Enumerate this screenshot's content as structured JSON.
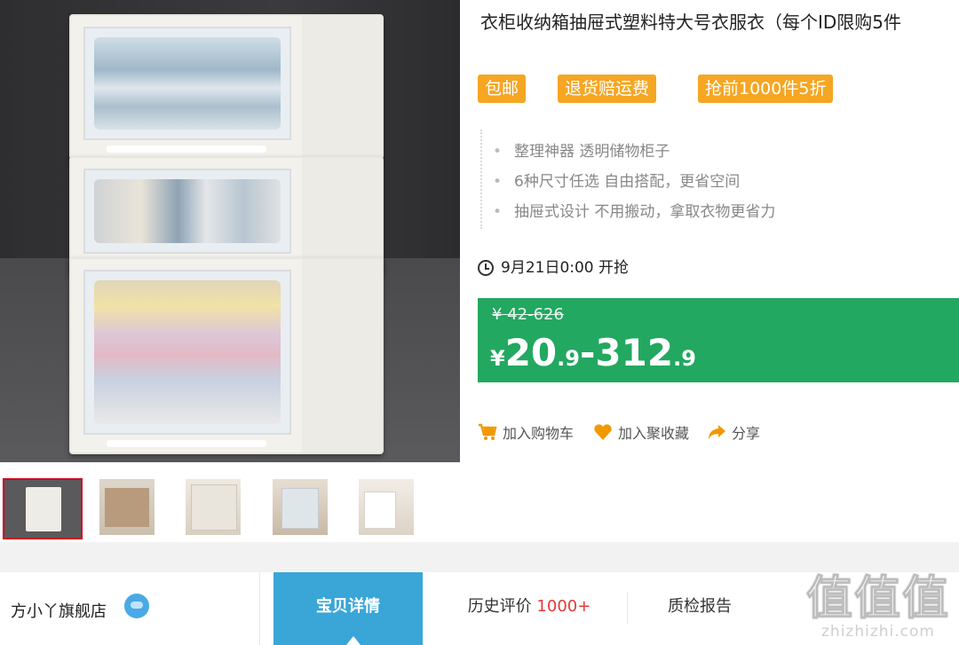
{
  "product": {
    "title": "衣柜收纳箱抽屉式塑料特大号衣服衣（每个ID限购5件",
    "tags": [
      "包邮",
      "退货赔运费",
      "抢前1000件5折"
    ],
    "features": [
      "整理神器 透明储物柜子",
      "6种尺寸任选 自由搭配，更省空间",
      "抽屉式设计 不用搬动，拿取衣物更省力"
    ],
    "start_time": "9月21日0:00 开抢"
  },
  "price": {
    "original": "¥ 42-626",
    "currency": "¥",
    "low_int": "20",
    "low_dec": ".9",
    "dash": "-",
    "high_int": "312",
    "high_dec": ".9"
  },
  "actions": {
    "cart": "加入购物车",
    "favorite": "加入聚收藏",
    "share": "分享"
  },
  "shop": {
    "name": "方小丫旗舰店"
  },
  "tabs": {
    "details": "宝贝详情",
    "reviews": "历史评价",
    "reviews_count": "1000+",
    "qc": "质检报告"
  },
  "watermark": {
    "logo": "值值值",
    "site": "zhizhizhi.com"
  },
  "colors": {
    "tag_orange": "#f5a623",
    "price_green": "#22a860",
    "tab_blue": "#3aa6d8",
    "thumb_selected": "#d0021b",
    "icon_orange": "#f39800"
  },
  "icons": [
    "clock-icon",
    "cart-icon",
    "heart-icon",
    "share-icon",
    "chat-icon"
  ]
}
